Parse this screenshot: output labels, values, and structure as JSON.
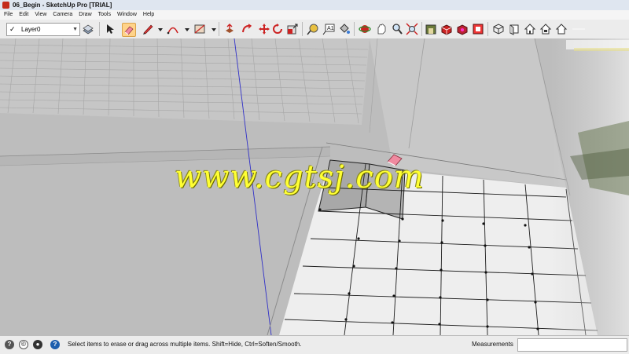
{
  "window": {
    "title": "06_Begin - SketchUp Pro [TRIAL]"
  },
  "menu": [
    "File",
    "Edit",
    "View",
    "Camera",
    "Draw",
    "Tools",
    "Window",
    "Help"
  ],
  "toolbar": {
    "layer_name": "Layer0",
    "icons": [
      "select-icon",
      "eraser-icon",
      "pencil-icon",
      "arc-icon",
      "rectangle-icon",
      "push-pull-icon",
      "follow-me-icon",
      "move-icon",
      "rotate-icon",
      "scale-icon",
      "tape-measure-icon",
      "text-icon",
      "paint-bucket-icon",
      "orbit-icon",
      "pan-icon",
      "zoom-icon",
      "zoom-extents-icon",
      "warehouse-icon",
      "components-icon",
      "materials-icon",
      "styles-icon",
      "iso-view-icon",
      "top-view-icon",
      "front-view-icon",
      "right-view-icon",
      "back-view-icon",
      "left-view-icon"
    ]
  },
  "viewport": {
    "watermark": "www.cgtsj.com"
  },
  "status": {
    "hint": "Select items to erase or drag across multiple items. Shift=Hide, Ctrl=Soften/Smooth.",
    "measurements_label": "Measurements",
    "measurements_value": ""
  },
  "colors": {
    "active_tool": "#ffd38a",
    "eraser": "#f08aa0",
    "watermark": "#ffff33",
    "blue_axis": "#3030c8"
  }
}
